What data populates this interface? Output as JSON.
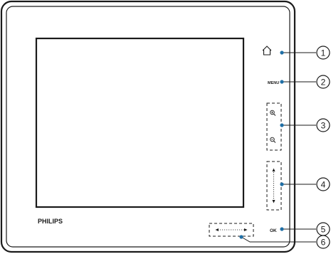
{
  "device": {
    "brand": "PHILIPS",
    "menu_label": "MENU",
    "ok_label": "OK"
  },
  "callouts": [
    {
      "number": "1",
      "name": "home-button"
    },
    {
      "number": "2",
      "name": "menu-button"
    },
    {
      "number": "3",
      "name": "zoom-buttons"
    },
    {
      "number": "4",
      "name": "vertical-scroll-strip"
    },
    {
      "number": "5",
      "name": "ok-button"
    },
    {
      "number": "6",
      "name": "horizontal-scroll-strip"
    }
  ],
  "icons": {
    "home": "home-icon",
    "zoom_in": "zoom-in-icon",
    "zoom_out": "zoom-out-icon"
  },
  "colors": {
    "outline": "#1a1a1a",
    "callout_dot": "#1f6fa6"
  }
}
